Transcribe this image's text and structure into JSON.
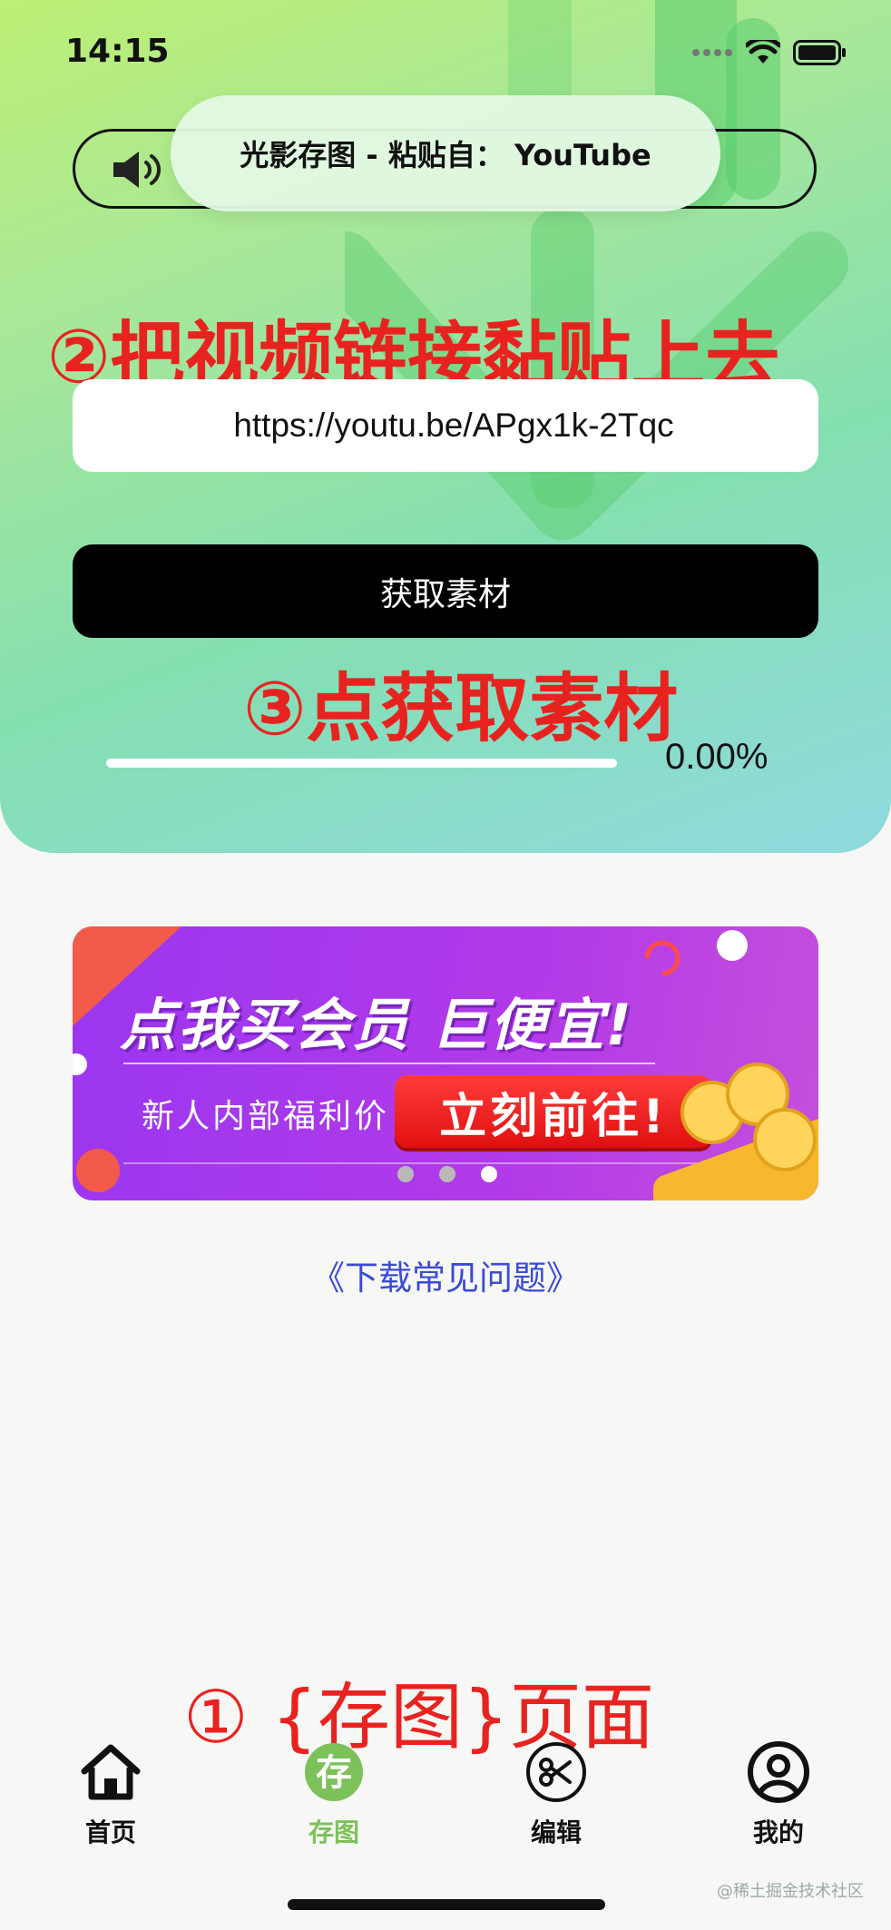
{
  "status": {
    "time": "14:15",
    "icons": [
      "signal-dots-icon",
      "wifi-icon",
      "battery-icon"
    ]
  },
  "toast": {
    "text": "光影存图 - 粘贴自： YouTube"
  },
  "annotations": {
    "step2": "②把视频链接黏贴上去",
    "step3": "③点获取素材",
    "step1": "① {存图}页面",
    "color": "#e8231f"
  },
  "url_field": {
    "value": "https://youtu.be/APgx1k-2Tqc",
    "placeholder": ""
  },
  "fetch_button": {
    "label": "获取素材"
  },
  "progress": {
    "value": 0.0,
    "text": "0.00%"
  },
  "banner": {
    "title": "点我买会员 巨便宜!",
    "subtitle": "新人内部福利价",
    "cta": "立刻前往!",
    "carousel_pages": 3,
    "active_page": 3
  },
  "faq_link": {
    "text": "《下载常见问题》"
  },
  "tabs": [
    {
      "label": "首页",
      "icon": "home-icon",
      "active": false
    },
    {
      "label": "存图",
      "icon": "save-image-icon",
      "active": true
    },
    {
      "label": "编辑",
      "icon": "scissors-icon",
      "active": false
    },
    {
      "label": "我的",
      "icon": "user-icon",
      "active": false
    }
  ],
  "colors": {
    "accent_green": "#7dc15a",
    "link_blue": "#3a4bd6",
    "button_black": "#000000"
  },
  "watermark": "@稀土掘金技术社区"
}
